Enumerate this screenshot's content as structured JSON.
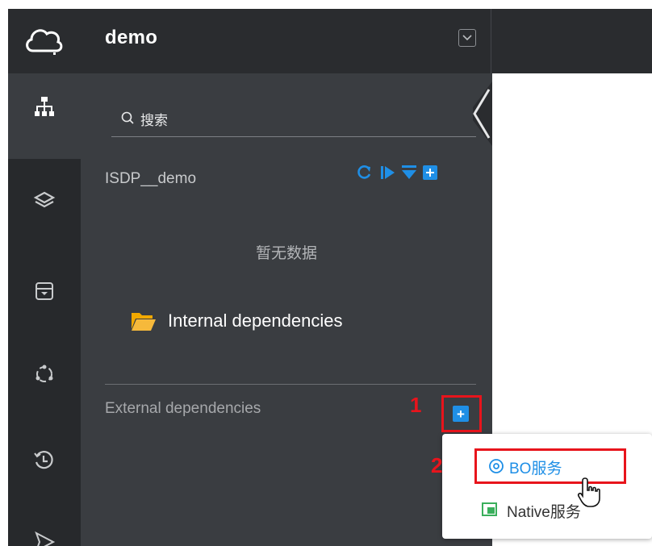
{
  "header": {
    "app_title": "demo",
    "dropdown_icon": "chevron-down-icon"
  },
  "rail": {
    "items": [
      {
        "icon": "sitemap-icon",
        "active": true
      },
      {
        "icon": "layers-icon",
        "active": false
      },
      {
        "icon": "archive-download-icon",
        "active": false
      },
      {
        "icon": "nodes-icon",
        "active": false
      },
      {
        "icon": "history-icon",
        "active": false
      },
      {
        "icon": "send-icon",
        "active": false
      }
    ]
  },
  "panel": {
    "search_placeholder": "搜索",
    "project_name": "ISDP__demo",
    "project_actions": [
      "refresh-icon",
      "play-icon",
      "collapse-icon",
      "add-icon"
    ],
    "empty_text": "暂无数据",
    "internal_label": "Internal dependencies",
    "external_label": "External dependencies"
  },
  "annotations": {
    "step1": "1",
    "step2": "2"
  },
  "menu": {
    "items": [
      {
        "label": "BO服务",
        "icon": "bo-service-icon"
      },
      {
        "label": "Native服务",
        "icon": "native-service-icon"
      }
    ]
  },
  "colors": {
    "accent": "#1f8fe6",
    "highlight": "#e8141c",
    "panel_bg": "#3a3d41",
    "rail_bg": "#27292c",
    "header_bg": "#2a2c2f"
  }
}
